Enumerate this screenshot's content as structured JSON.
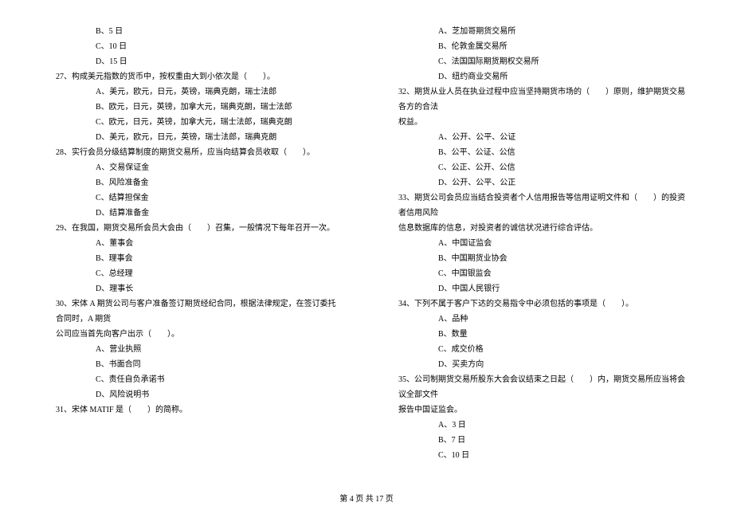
{
  "left": {
    "opt_b5": "B、5 日",
    "opt_c10": "C、10 日",
    "opt_d15": "D、15 日",
    "q27": "27、构成美元指数的货币中，按权重由大到小依次是（　　）。",
    "q27a": "A、美元，欧元，日元，英镑，瑞典克朗，瑞士法郎",
    "q27b": "B、欧元，日元，英镑，加拿大元，瑞典克朗，瑞士法郎",
    "q27c": "C、欧元，日元，英镑，加拿大元，瑞士法郎，瑞典克朗",
    "q27d": "D、美元，欧元，日元，英镑，瑞士法郎，瑞典克朗",
    "q28": "28、实行会员分级结算制度的期货交易所，应当向结算会员收取（　　）。",
    "q28a": "A、交易保证金",
    "q28b": "B、风险准备金",
    "q28c": "C、结算担保金",
    "q28d": "D、结算准备金",
    "q29": "29、在我国，期货交易所会员大会由（　　）召集，一般情况下每年召开一次。",
    "q29a": "A、董事会",
    "q29b": "B、理事会",
    "q29c": "C、总经理",
    "q29d": "D、理事长",
    "q30": "30、宋体 A 期货公司与客户准备签订期货经纪合同，根据法律规定，在签订委托合同时，A 期货",
    "q30cont": "公司应当首先向客户出示（　　）。",
    "q30a": "A、营业执照",
    "q30b": "B、书面合同",
    "q30c": "C、责任自负承诺书",
    "q30d": "D、风险说明书",
    "q31": "31、宋体 MATIF 是（　　）的简称。"
  },
  "right": {
    "q31a": "A、芝加哥期货交易所",
    "q31b": "B、伦敦金属交易所",
    "q31c": "C、法国国际期货期权交易所",
    "q31d": "D、纽约商业交易所",
    "q32": "32、期货从业人员在执业过程中应当坚持期货市场的（　　）原则，维护期货交易各方的合法",
    "q32cont": "权益。",
    "q32a": "A、公开、公平、公证",
    "q32b": "B、公平、公证、公信",
    "q32c": "C、公正、公开、公信",
    "q32d": "D、公开、公平、公正",
    "q33": "33、期货公司会员应当结合投资者个人信用报告等信用证明文件和（　　）的投资者信用风险",
    "q33cont": "信息数据库的信息，对投资者的诚信状况进行综合评估。",
    "q33a": "A、中国证监会",
    "q33b": "B、中国期货业协会",
    "q33c": "C、中国银监会",
    "q33d": "D、中国人民银行",
    "q34": "34、下列不属于客户下达的交易指令中必须包括的事项是（　　）。",
    "q34a": "A、品种",
    "q34b": "B、数量",
    "q34c": "C、成交价格",
    "q34d": "D、买卖方向",
    "q35": "35、公司制期货交易所股东大会会议结束之日起（　　）内，期货交易所应当将会议全部文件",
    "q35cont": "报告中国证监会。",
    "q35a": "A、3 日",
    "q35b": "B、7 日",
    "q35c": "C、10 日"
  },
  "footer": "第 4 页 共 17 页"
}
